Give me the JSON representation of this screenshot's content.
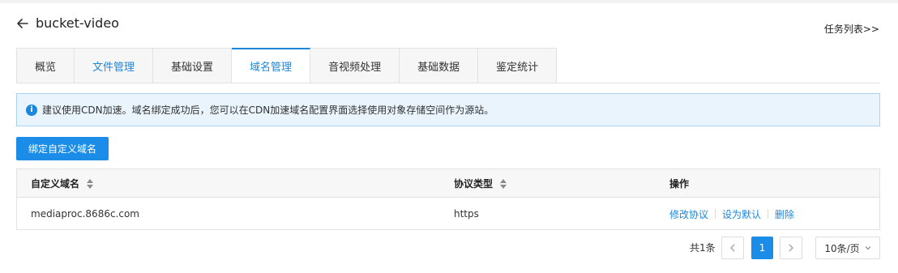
{
  "header": {
    "title": "bucket-video",
    "task_link": "任务列表>>"
  },
  "tabs": [
    {
      "label": "概览"
    },
    {
      "label": "文件管理"
    },
    {
      "label": "基础设置"
    },
    {
      "label": "域名管理"
    },
    {
      "label": "音视频处理"
    },
    {
      "label": "基础数据"
    },
    {
      "label": "鉴定统计"
    }
  ],
  "notice": {
    "icon_text": "i",
    "text": "建议使用CDN加速。域名绑定成功后，您可以在CDN加速域名配置界面选择使用对象存储空间作为源站。"
  },
  "actions": {
    "bind_label": "绑定自定义域名"
  },
  "table": {
    "columns": [
      "自定义域名",
      "协议类型",
      "操作"
    ],
    "rows": [
      {
        "domain": "mediaproc.8686c.com",
        "protocol": "https",
        "ops": [
          "修改协议",
          "设为默认",
          "删除"
        ]
      }
    ]
  },
  "pagination": {
    "total": "共1条",
    "current_page": "1",
    "page_size": "10条/页"
  },
  "colors": {
    "accent": "#1b87dd",
    "button": "#1b8de8",
    "notice_bg": "#e9f4fc",
    "notice_border": "#a8d2f1"
  }
}
